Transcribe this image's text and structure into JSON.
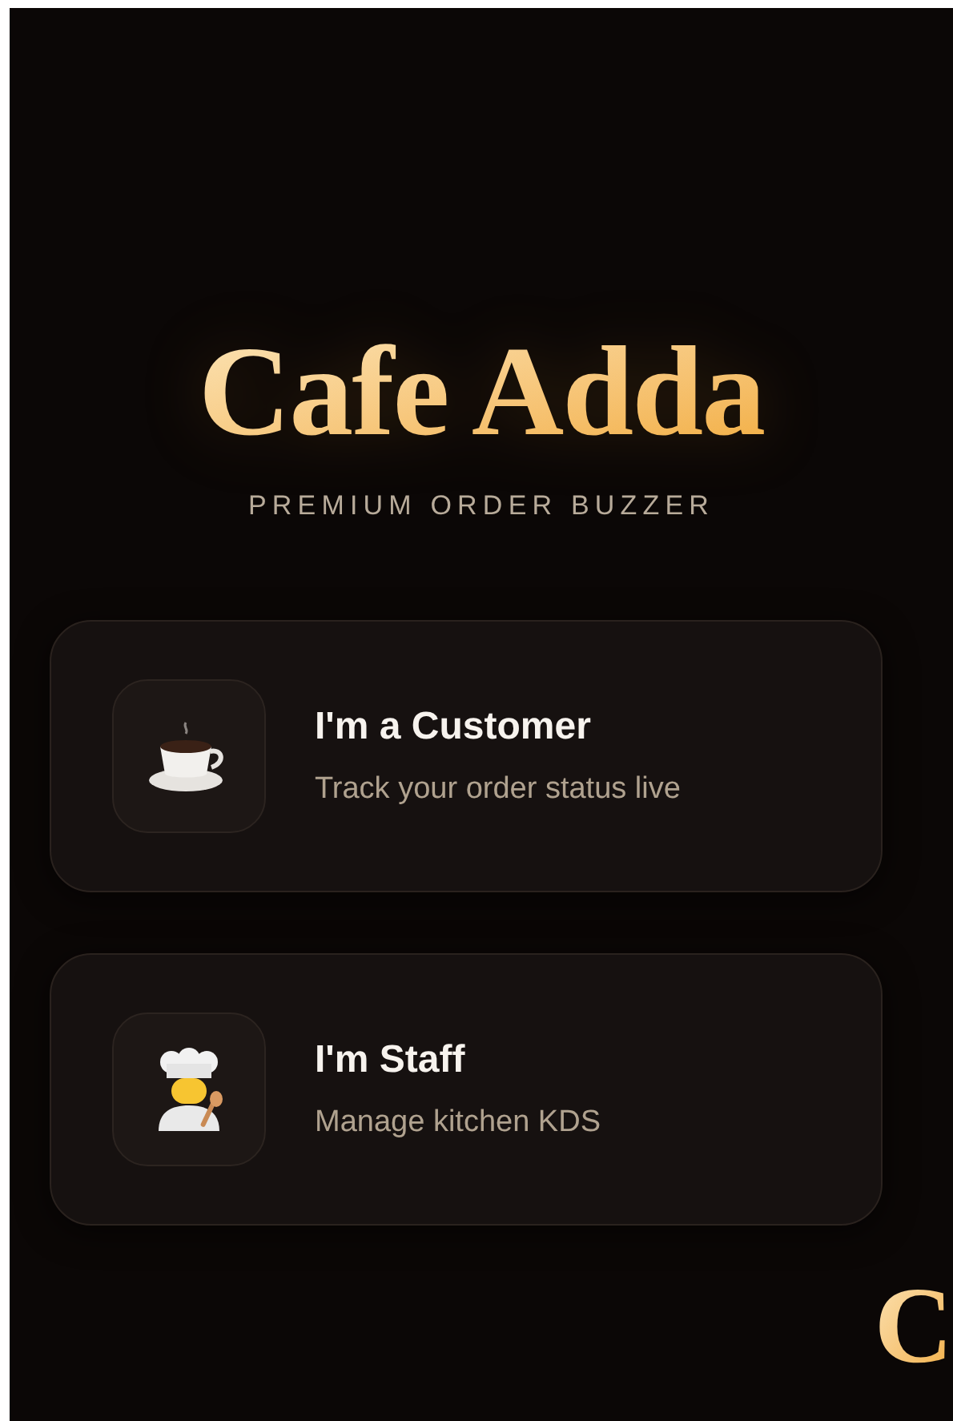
{
  "brand": {
    "title": "Cafe Adda",
    "tagline": "PREMIUM ORDER BUZZER"
  },
  "roles": [
    {
      "kind": "customer",
      "title": "I'm a Customer",
      "subtitle": "Track your order status live"
    },
    {
      "kind": "staff",
      "title": "I'm Staff",
      "subtitle": "Manage kitchen KDS"
    }
  ],
  "corner_letter": "C"
}
